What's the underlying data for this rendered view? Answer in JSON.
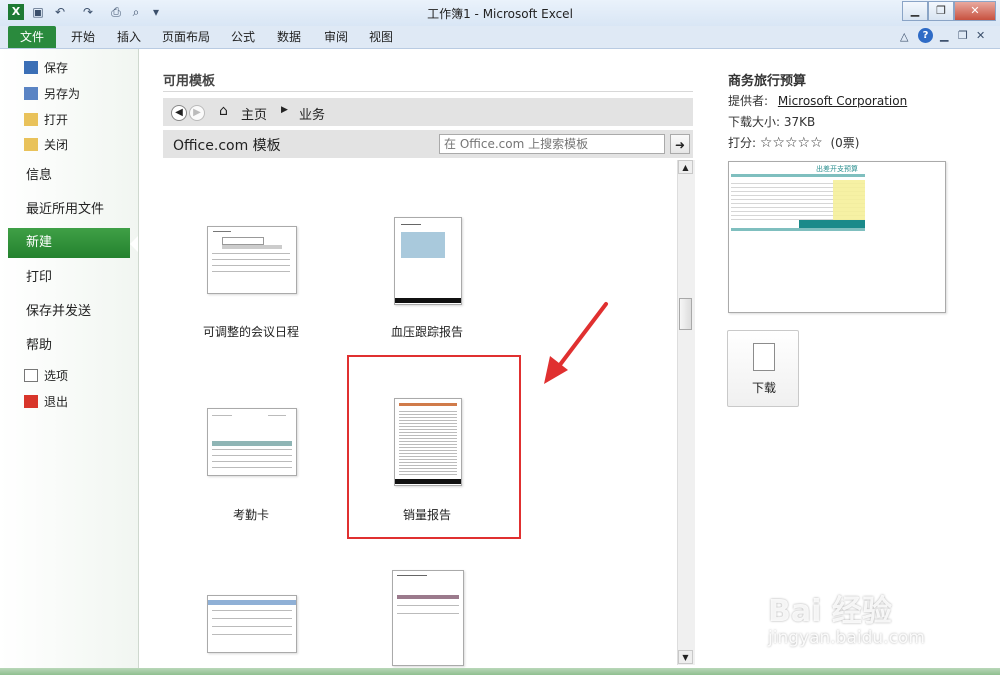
{
  "window": {
    "title": "工作簿1 - Microsoft Excel",
    "excel_logo": "X",
    "minimize_icon": "minimize-icon",
    "restore_icon": "restore-icon",
    "close_icon": "close-icon"
  },
  "ribbon": {
    "tabs": [
      "文件",
      "开始",
      "插入",
      "页面布局",
      "公式",
      "数据",
      "审阅",
      "视图"
    ]
  },
  "backstage": {
    "small_items_top": [
      "保存",
      "另存为",
      "打开",
      "关闭"
    ],
    "big_items": [
      "信息",
      "最近所用文件",
      "新建",
      "打印",
      "保存并发送",
      "帮助"
    ],
    "small_items_bottom": [
      "选项",
      "退出"
    ],
    "selected": "新建"
  },
  "templates": {
    "heading": "可用模板",
    "breadcrumb": {
      "home": "主页",
      "current": "业务"
    },
    "source_label": "Office.com 模板",
    "search_placeholder": "在 Office.com 上搜索模板",
    "items": [
      {
        "label": "可调整的会议日程"
      },
      {
        "label": "血压跟踪报告"
      },
      {
        "label": "考勤卡"
      },
      {
        "label": "销量报告"
      }
    ]
  },
  "details": {
    "title": "商务旅行预算",
    "provider_label": "提供者:",
    "provider": "Microsoft Corporation",
    "size": "下载大小: 37KB",
    "rating_label": "打分:",
    "stars": "☆☆☆☆☆",
    "votes": "(0票)",
    "preview_heading": "出差开支预算",
    "download_label": "下载"
  },
  "watermark": {
    "line1": "Bai 经验",
    "line2": "jingyan.baidu.com"
  },
  "colors": {
    "file_tab": "#2a8a3d",
    "selected_nav": "#2f9239",
    "highlight": "#e03030",
    "watermark": "#ffffff"
  }
}
